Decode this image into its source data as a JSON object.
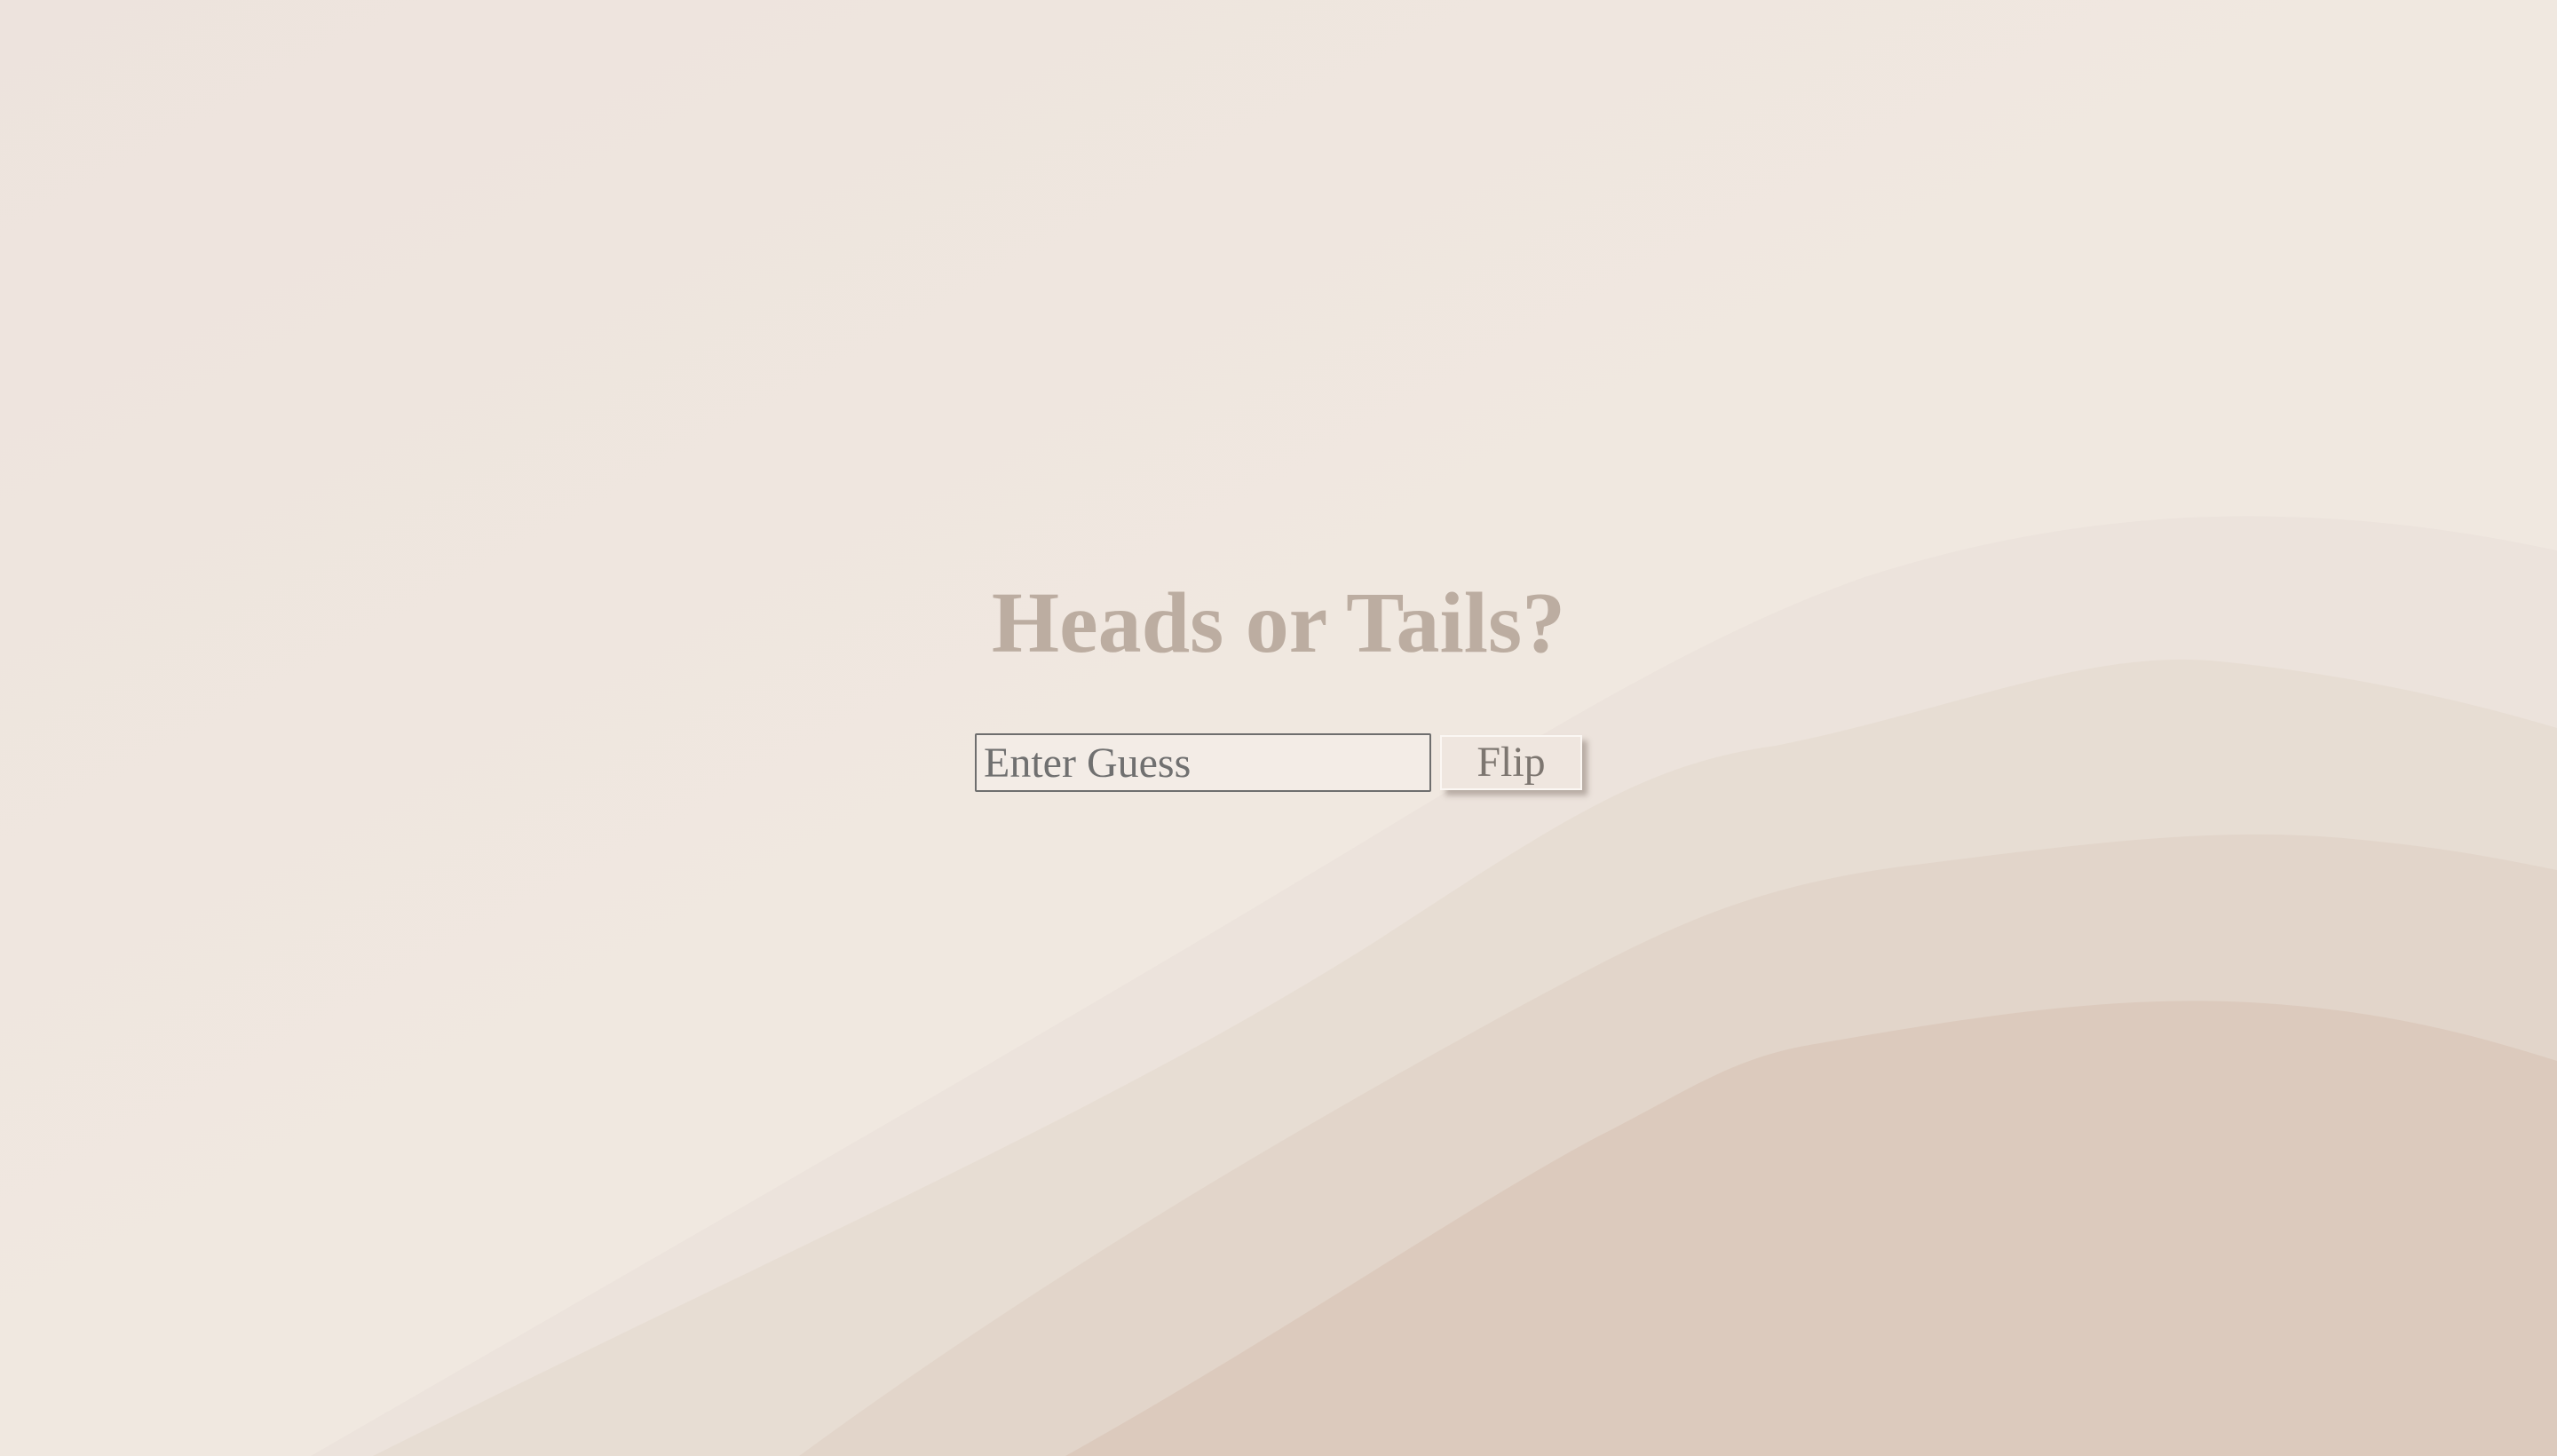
{
  "page": {
    "title": "Heads or Tails?",
    "background_color": "#f0e7df",
    "title_color": "#bcada1"
  },
  "form": {
    "guess_placeholder": "Enter Guess",
    "guess_value": "",
    "flip_label": "Flip"
  }
}
